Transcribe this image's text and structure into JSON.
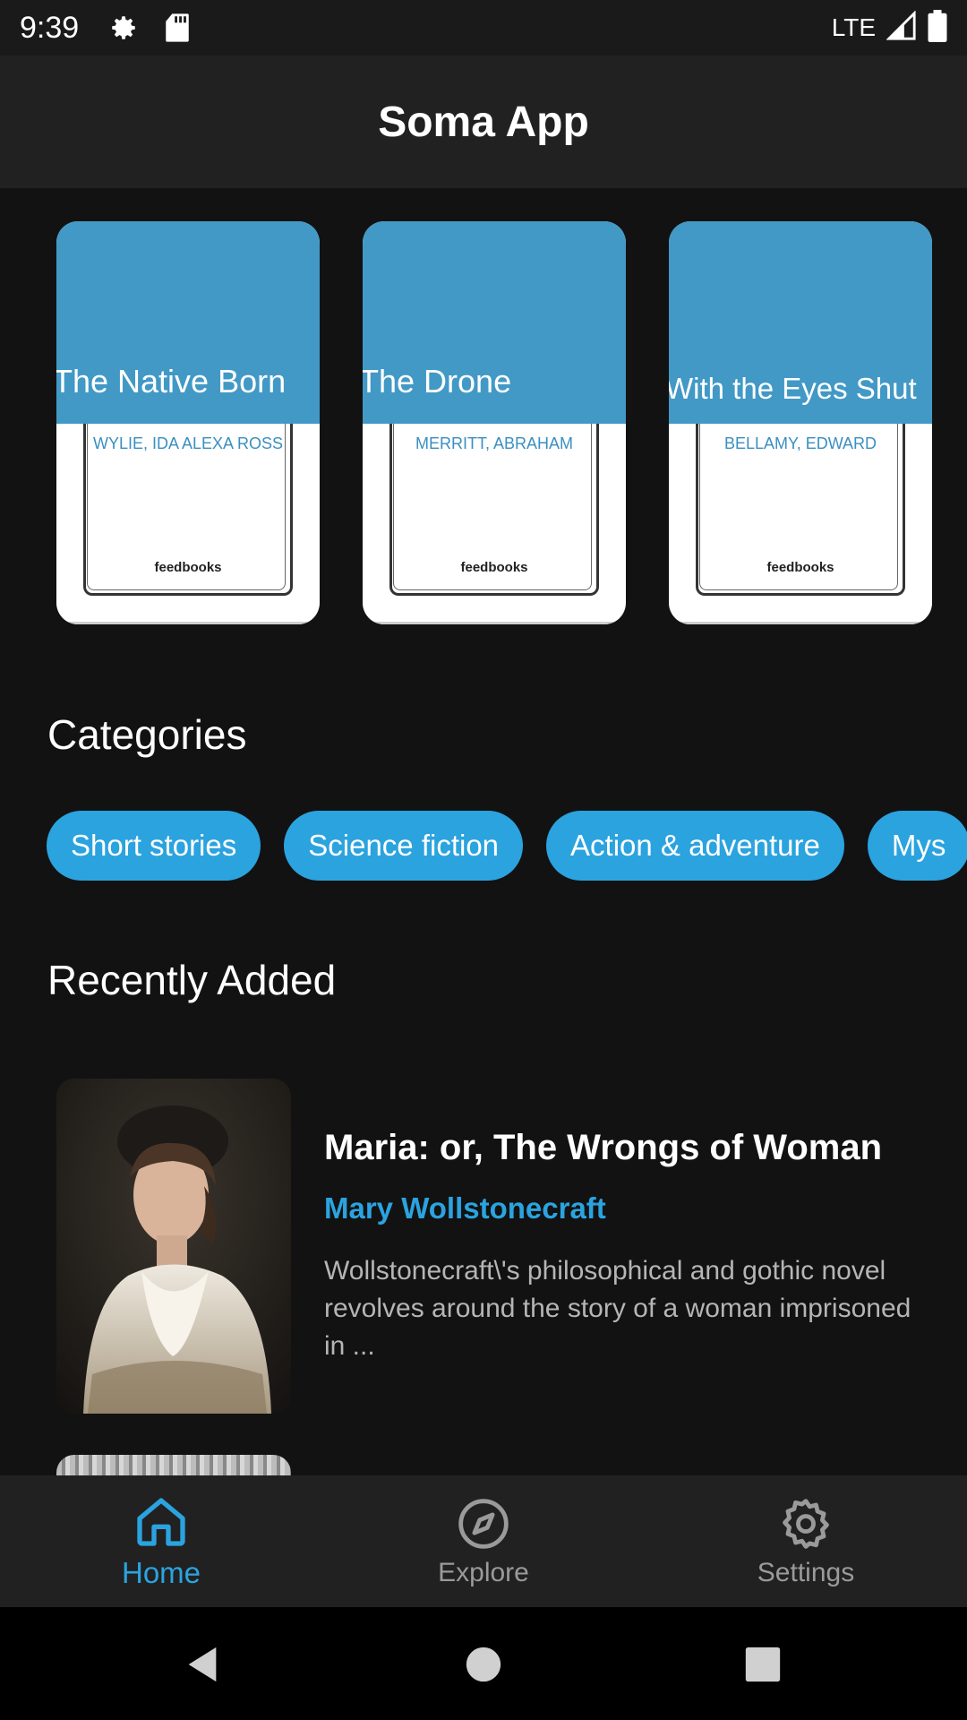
{
  "status_bar": {
    "time": "9:39",
    "network": "LTE",
    "icons": [
      "gear-icon",
      "sd-card-icon",
      "signal-icon",
      "battery-icon"
    ]
  },
  "app_bar": {
    "title": "Soma App"
  },
  "featured_books": [
    {
      "title": "The Native Born",
      "author": "WYLIE, IDA ALEXA ROSS",
      "publisher": "feedbooks"
    },
    {
      "title": "The Drone",
      "author": "MERRITT, ABRAHAM",
      "publisher": "feedbooks"
    },
    {
      "title": "With the Eyes Shut",
      "author": "BELLAMY, EDWARD",
      "publisher": "feedbooks"
    }
  ],
  "categories": {
    "heading": "Categories",
    "items": [
      "Short stories",
      "Science fiction",
      "Action & adventure",
      "Mys"
    ]
  },
  "recently_added": {
    "heading": "Recently Added",
    "items": [
      {
        "title": "Maria: or, The Wrongs of Woman",
        "author": "Mary Wollstonecraft",
        "description": "Wollstonecraft\\'s philosophical and gothic novel revolves around the story of a woman imprisoned in ..."
      }
    ]
  },
  "bottom_nav": {
    "items": [
      {
        "label": "Home",
        "icon": "home-icon",
        "active": true
      },
      {
        "label": "Explore",
        "icon": "compass-icon",
        "active": false
      },
      {
        "label": "Settings",
        "icon": "gear-icon",
        "active": false
      }
    ]
  },
  "colors": {
    "accent": "#2ba3df",
    "cover_blue": "#4299c6",
    "background": "#121212",
    "bar": "#212121"
  }
}
